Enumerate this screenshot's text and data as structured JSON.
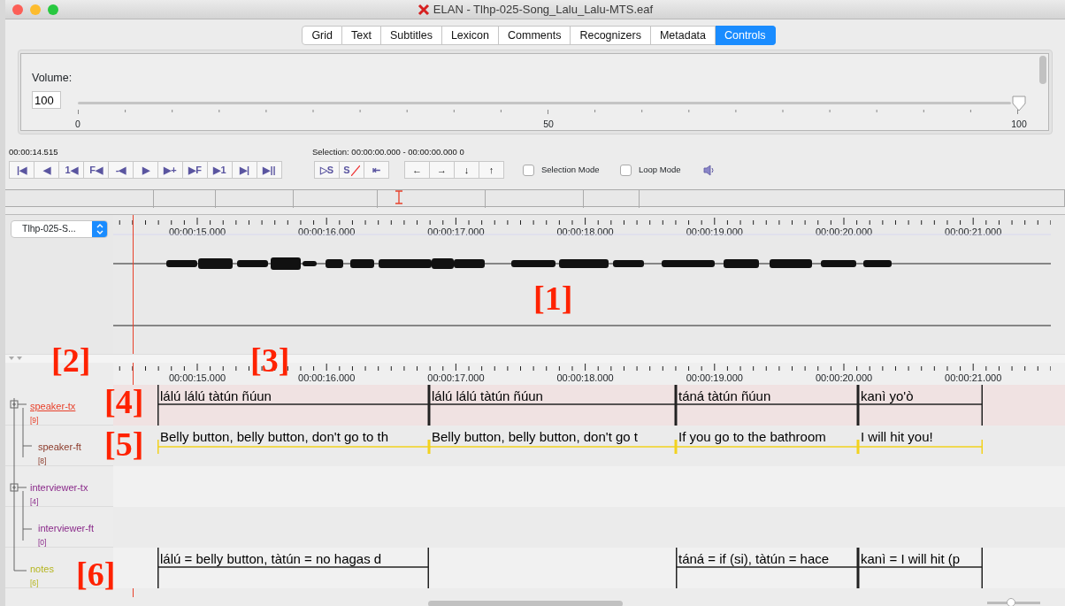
{
  "window": {
    "title": "ELAN - Tlhp-025-Song_Lalu_Lalu-MTS.eaf"
  },
  "tabs": [
    {
      "label": "Grid",
      "selected": false
    },
    {
      "label": "Text",
      "selected": false
    },
    {
      "label": "Subtitles",
      "selected": false
    },
    {
      "label": "Lexicon",
      "selected": false
    },
    {
      "label": "Comments",
      "selected": false
    },
    {
      "label": "Recognizers",
      "selected": false
    },
    {
      "label": "Metadata",
      "selected": false
    },
    {
      "label": "Controls",
      "selected": true
    }
  ],
  "volume": {
    "label": "Volume:",
    "value": "100",
    "level": 1,
    "tick_labels": [
      "0",
      "50",
      "100"
    ]
  },
  "media_time": "00:00:14.515",
  "selection": "Selection: 00:00:00.000 - 00:00:00.000  0",
  "player_buttons": [
    {
      "glyph": "|◀"
    },
    {
      "glyph": "◀"
    },
    {
      "glyph": "1◀"
    },
    {
      "glyph": "F◀"
    },
    {
      "glyph": "-◀"
    },
    {
      "glyph": "▶"
    },
    {
      "glyph": "▶+"
    },
    {
      "glyph": "▶F"
    },
    {
      "glyph": "▶1"
    },
    {
      "glyph": "▶|"
    },
    {
      "glyph": "▶||"
    }
  ],
  "selection_buttons": [
    {
      "glyph": "▷S"
    },
    {
      "glyph": "S"
    },
    {
      "glyph": "⇤"
    }
  ],
  "navigation_buttons": [
    {
      "glyph": "←"
    },
    {
      "glyph": "→"
    },
    {
      "glyph": "↓"
    },
    {
      "glyph": "↑"
    }
  ],
  "modes": [
    {
      "label": "Selection Mode",
      "checked": false
    },
    {
      "label": "Loop Mode",
      "checked": false
    }
  ],
  "media_select": "Tlhp-025-S...",
  "waveform_ruler": [
    "00:00:15.000",
    "00:00:16.000",
    "00:00:17.000",
    "00:00:18.000",
    "00:00:19.000",
    "00:00:20.000",
    "00:00:21.000"
  ],
  "annotation_ruler": [
    "00:00:15.000",
    "00:00:16.000",
    "00:00:17.000",
    "00:00:18.000",
    "00:00:19.000",
    "00:00:20.000",
    "00:00:21.000"
  ],
  "tiers": [
    {
      "name": "speaker-tx",
      "count": "[9]",
      "color": "#e8402a",
      "selected": true,
      "annotations": [
        "lálú lálú tàtún ñúun",
        "lálú lálú tàtún ñúun",
        "táná tàtún ñúun",
        "kanì yo'ò"
      ],
      "children": [
        {
          "name": "speaker-ft",
          "count": "[8]",
          "color": "#8b3a2a",
          "selected": false,
          "annotations": [
            "Belly button, belly button, don't go to th",
            "Belly button, belly button, don't go t",
            "If you go to the bathroom",
            "I will hit you!"
          ]
        }
      ]
    },
    {
      "name": "interviewer-tx",
      "count": "[4]",
      "color": "#8a2a8a",
      "selected": false,
      "children": [
        {
          "name": "interviewer-ft",
          "count": "[0]",
          "color": "#8a2a8a",
          "selected": false
        }
      ]
    },
    {
      "name": "notes",
      "count": "[6]",
      "color": "#b5b51e",
      "selected": false,
      "annotations": [
        "lálú = belly button, tàtún = no hagas d",
        "táná = if (si), tàtún = hace",
        "kanì = I will hit (p"
      ]
    }
  ],
  "zoom": {
    "level": 0.45
  },
  "callouts": [
    "[1]",
    "[2]",
    "[3]",
    "[4]",
    "[5]",
    "[6]"
  ]
}
